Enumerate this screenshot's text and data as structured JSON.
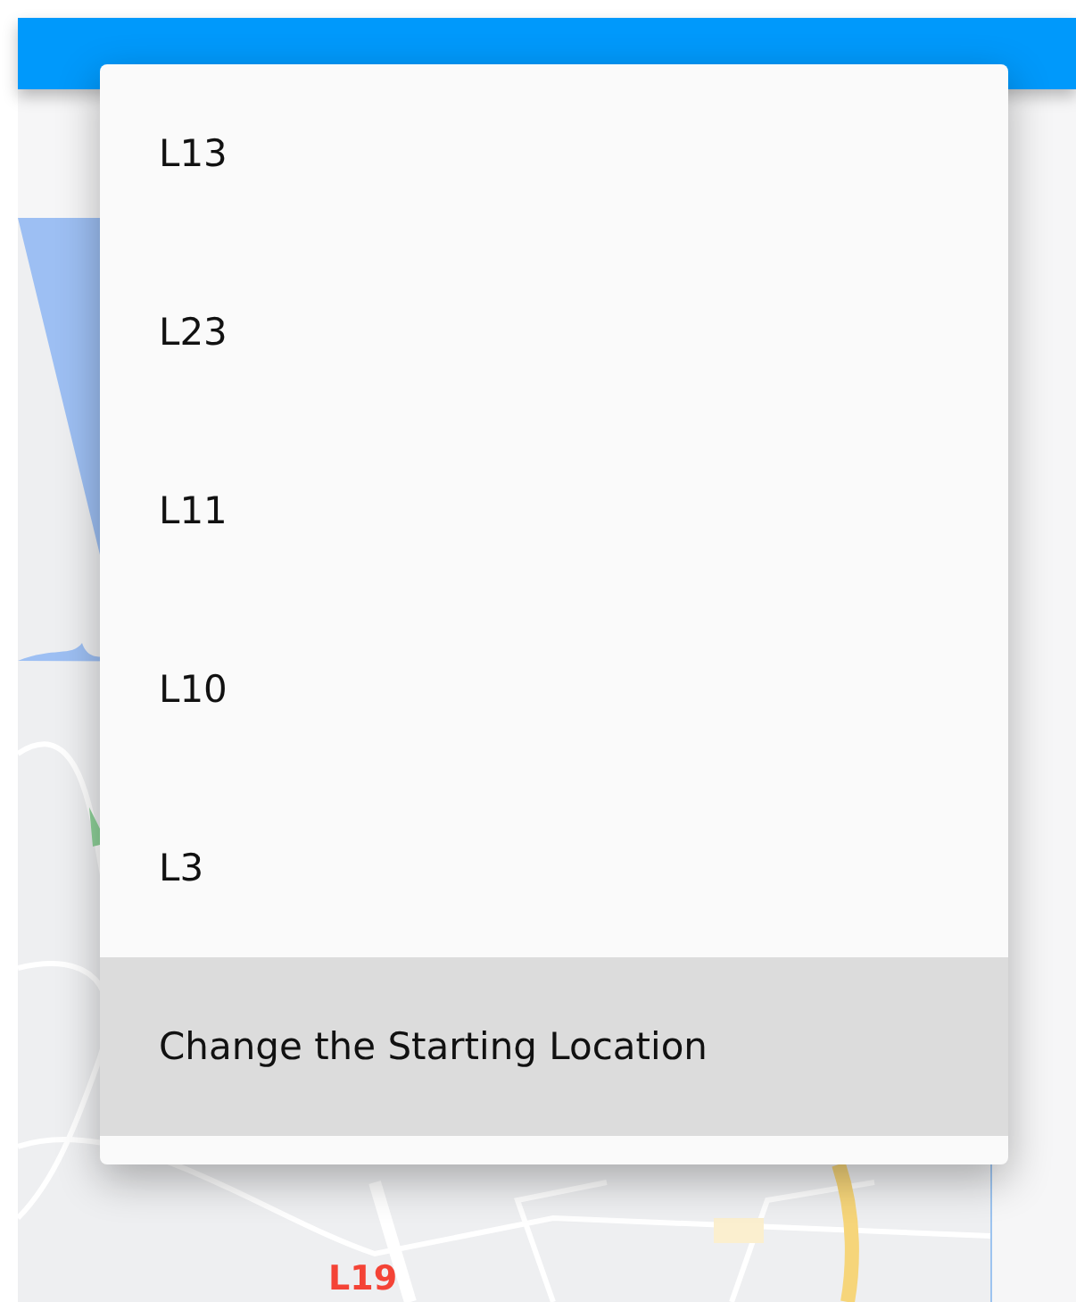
{
  "map": {
    "label": "L19"
  },
  "menu": {
    "items": [
      {
        "label": "L13",
        "selected": false
      },
      {
        "label": "L23",
        "selected": false
      },
      {
        "label": "L11",
        "selected": false
      },
      {
        "label": "L10",
        "selected": false
      },
      {
        "label": "L3",
        "selected": false
      },
      {
        "label": "Change the Starting Location",
        "selected": true
      }
    ]
  }
}
